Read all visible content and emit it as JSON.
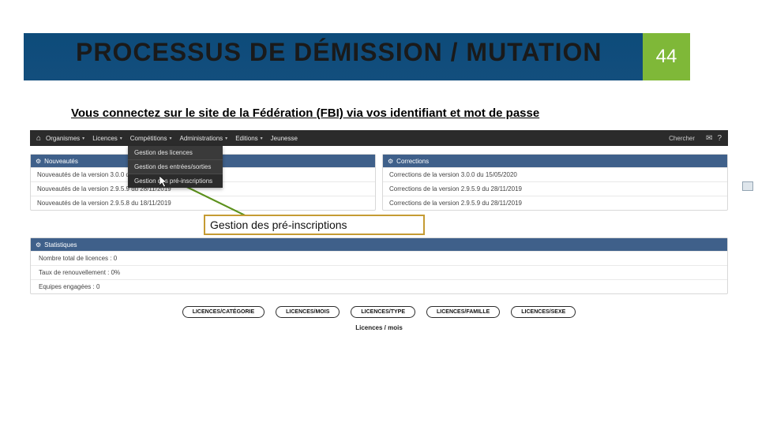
{
  "slide": {
    "title": "PROCESSUS DE DÉMISSION / MUTATION",
    "page_number": "44",
    "subtitle": "Vous connectez sur le site de la Fédération (FBI) via vos identifiant et mot de passe"
  },
  "topbar": {
    "items": [
      "Organismes",
      "Licences",
      "Compétitions",
      "Administrations",
      "Editions",
      "Jeunesse"
    ],
    "search": "Chercher"
  },
  "dropdown": {
    "items": [
      {
        "label": "Gestion des licences",
        "active": false
      },
      {
        "label": "Gestion des entrées/sorties",
        "active": false
      },
      {
        "label": "Gestion des pré-inscriptions",
        "active": true
      }
    ]
  },
  "panel_left": {
    "title": "Nouveautés",
    "rows": [
      "Nouveautés de la version 3.0.0 du 15/05/2020",
      "Nouveautés de la version 2.9.5.9 du 28/11/2019",
      "Nouveautés de la version 2.9.5.8 du 18/11/2019"
    ]
  },
  "panel_right": {
    "title": "Corrections",
    "rows": [
      "Corrections de la version 3.0.0 du 15/05/2020",
      "Corrections de la version 2.9.5.9 du 28/11/2019",
      "Corrections de la version 2.9.5.9 du 28/11/2019"
    ]
  },
  "callout": {
    "label": "Gestion des pré-inscriptions"
  },
  "stats": {
    "title": "Statistiques",
    "rows": [
      "Nombre total de licences : 0",
      "Taux de renouvellement : 0%",
      "Equipes engagées : 0"
    ]
  },
  "buttons": [
    "LICENCES/CATÉGORIE",
    "LICENCES/MOIS",
    "LICENCES/TYPE",
    "LICENCES/FAMILLE",
    "LICENCES/SEXE"
  ],
  "bottom_label": "Licences / mois"
}
